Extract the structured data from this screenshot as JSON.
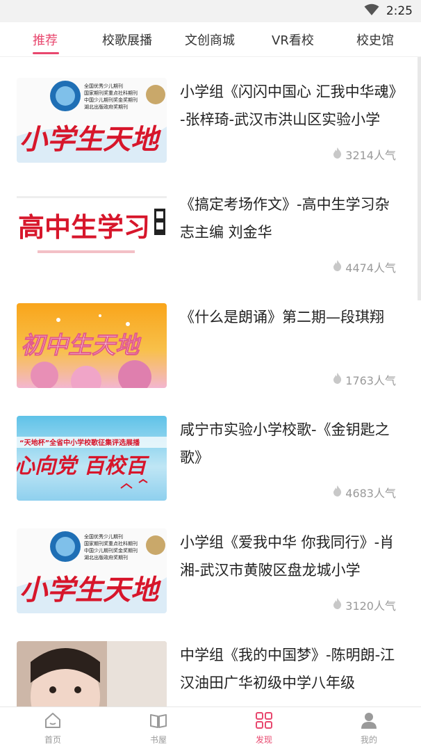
{
  "status": {
    "time": "2:25"
  },
  "tabs": [
    {
      "label": "推荐"
    },
    {
      "label": "校歌展播"
    },
    {
      "label": "文创商城"
    },
    {
      "label": "VR看校"
    },
    {
      "label": "校史馆"
    }
  ],
  "accent_color": "#e8476e",
  "feed": [
    {
      "title": "小学组《闪闪中国心 汇我中华魂》-张梓琦-武汉市洪山区实验小学",
      "popularity": "3214人气",
      "thumb_text": "小学生天地",
      "thumb_small": [
        "全国优秀少儿期刊",
        "国家期刊奖重点社科期刊",
        "中国少儿期刊奖金奖期刊",
        "湖北出版政府奖期刊"
      ]
    },
    {
      "title": "《搞定考场作文》-高中生学习杂志主编 刘金华",
      "popularity": "4474人气",
      "thumb_text": "高中生学习"
    },
    {
      "title": "《什么是朗诵》第二期—段琪翔",
      "popularity": "1763人气",
      "thumb_text": "初中生天地"
    },
    {
      "title": "咸宁市实验小学校歌-《金钥匙之歌》",
      "popularity": "4683人气",
      "thumb_text": "心向党 百校百",
      "thumb_banner": "“天地杯”全省中小学校歌征集评选展播"
    },
    {
      "title": "小学组《爱我中华 你我同行》-肖湘-武汉市黄陂区盘龙城小学",
      "popularity": "3120人气",
      "thumb_text": "小学生天地",
      "thumb_small": [
        "全国优秀少儿期刊",
        "国家期刊奖重点社科期刊",
        "中国少儿期刊奖金奖期刊",
        "湖北出版政府奖期刊"
      ]
    },
    {
      "title": "中学组《我的中国梦》-陈明朗-江汉油田广华初级中学八年级",
      "popularity": "",
      "thumb_text": ""
    }
  ],
  "bottom_nav": [
    {
      "label": "首页",
      "icon": "home-icon"
    },
    {
      "label": "书屋",
      "icon": "book-icon"
    },
    {
      "label": "发现",
      "icon": "discover-grid-icon"
    },
    {
      "label": "我的",
      "icon": "user-icon"
    }
  ]
}
